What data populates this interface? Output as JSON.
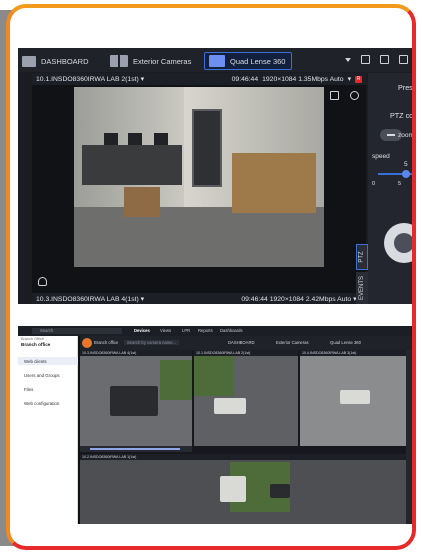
{
  "top_app": {
    "tabs": [
      {
        "label": "DASHBOARD",
        "icon": "dashboard-icon"
      },
      {
        "label": "Exterior Cameras",
        "icon": "cameras-layout-icon"
      },
      {
        "label": "Quad Lense 360",
        "icon": "quad-layout-icon",
        "active": true
      }
    ],
    "camera_1": {
      "name": "10.1.INSDO8360IRWA LAB 2(1st)",
      "time": "09:46:44",
      "stats": "1920×1084 1.35Mbps Auto",
      "rec_badge": "R"
    },
    "camera_2": {
      "name": "10.3.INSDO8360IRWA LAB 4(1st)",
      "time": "09:46:44",
      "stats": "1920×1084 2.42Mbps Auto",
      "rec_badge": "R"
    },
    "side_tabs": {
      "ptz": "PTZ",
      "events": "EVENTS"
    },
    "ptz_panel": {
      "presets": "Presets",
      "ptz_controls": "PTZ contro",
      "zoom": "zoom",
      "speed": "speed",
      "speed_value": "5",
      "slider_min": "0",
      "slider_max": "5"
    }
  },
  "bottom_app": {
    "search_placeholder": "Search",
    "nav": [
      "Devices",
      "Views",
      "LPR",
      "Reports",
      "Dashboards"
    ],
    "left_panel": {
      "breadcrumb": "Branch Office",
      "title": "Branch office",
      "items": [
        "Web clients",
        "Users and Groups",
        "Files",
        "Web configuration"
      ]
    },
    "app_bar": {
      "server": "Branch office",
      "search_placeholder": "Search by camera name...",
      "tabs": [
        "DASHBOARD",
        "Exterior Cameras",
        "Quad Lense 360"
      ]
    },
    "tiles": [
      {
        "name": "10.3.INSDO8360IRWA LAB 4(1st)"
      },
      {
        "name": "10.1.INSDO8360IRWA LAB 2(1st)"
      },
      {
        "name": "10.4.INSDO8360IRWA LAB 3(1st)"
      },
      {
        "name": "10.2.INSDO8360IRWA LAB 1(1st)"
      }
    ]
  },
  "colors": {
    "frame_orange": "#f39a1c",
    "frame_red": "#e62a2a",
    "active_blue": "#3a6fd8",
    "rec_red": "#e3282a"
  }
}
